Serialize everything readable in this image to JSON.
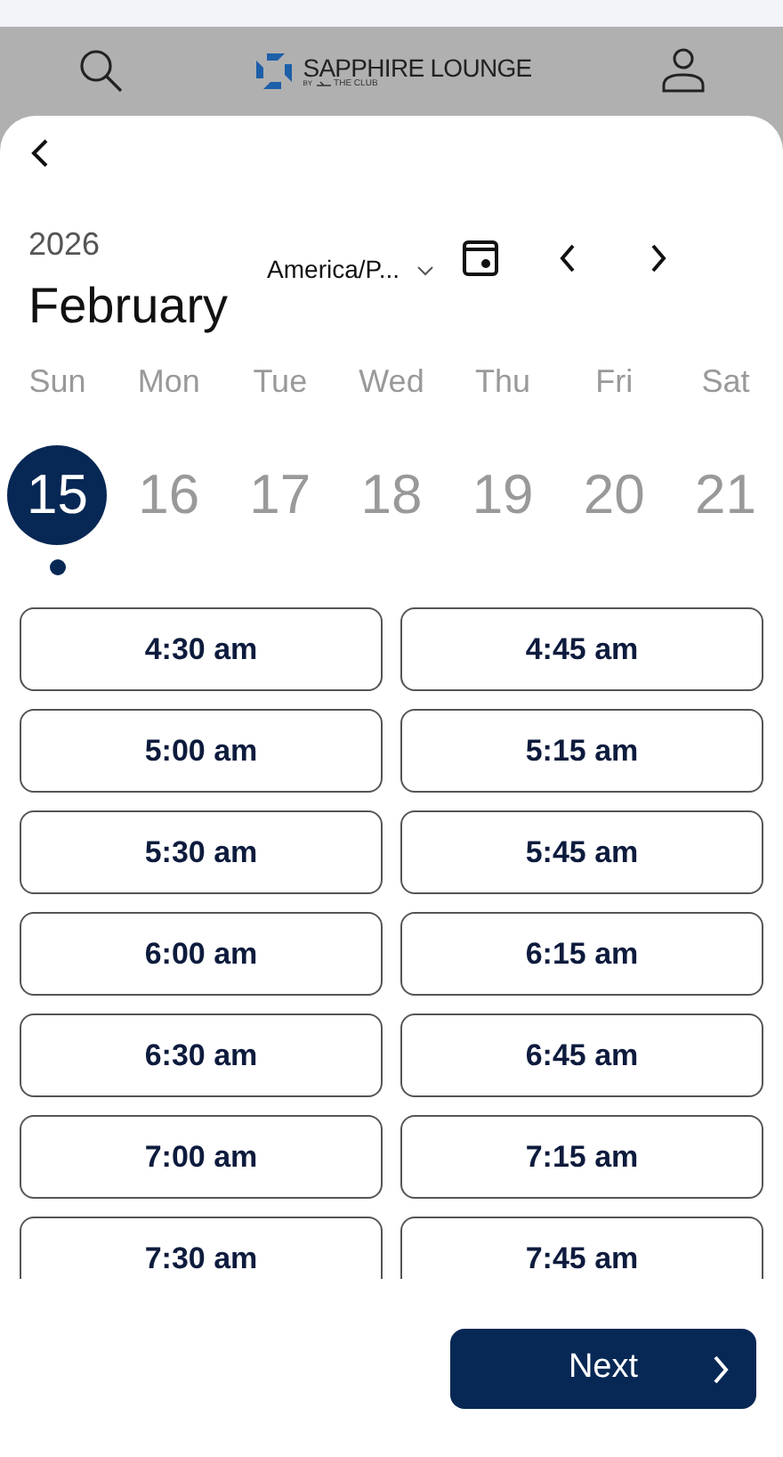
{
  "header": {
    "brand": "SAPPHIRE LOUNGE",
    "brand_sub_prefix": "BY",
    "brand_sub": "THE CLUB"
  },
  "calendar": {
    "year": "2026",
    "month": "February",
    "timezone": "America/P..."
  },
  "days": [
    {
      "weekday": "Sun",
      "day": "15",
      "selected": true,
      "has_dot": true
    },
    {
      "weekday": "Mon",
      "day": "16",
      "selected": false,
      "has_dot": false
    },
    {
      "weekday": "Tue",
      "day": "17",
      "selected": false,
      "has_dot": false
    },
    {
      "weekday": "Wed",
      "day": "18",
      "selected": false,
      "has_dot": false
    },
    {
      "weekday": "Thu",
      "day": "19",
      "selected": false,
      "has_dot": false
    },
    {
      "weekday": "Fri",
      "day": "20",
      "selected": false,
      "has_dot": false
    },
    {
      "weekday": "Sat",
      "day": "21",
      "selected": false,
      "has_dot": false
    }
  ],
  "slots": [
    "4:30 am",
    "4:45 am",
    "5:00 am",
    "5:15 am",
    "5:30 am",
    "5:45 am",
    "6:00 am",
    "6:15 am",
    "6:30 am",
    "6:45 am",
    "7:00 am",
    "7:15 am",
    "7:30 am",
    "7:45 am"
  ],
  "next_button": "Next"
}
